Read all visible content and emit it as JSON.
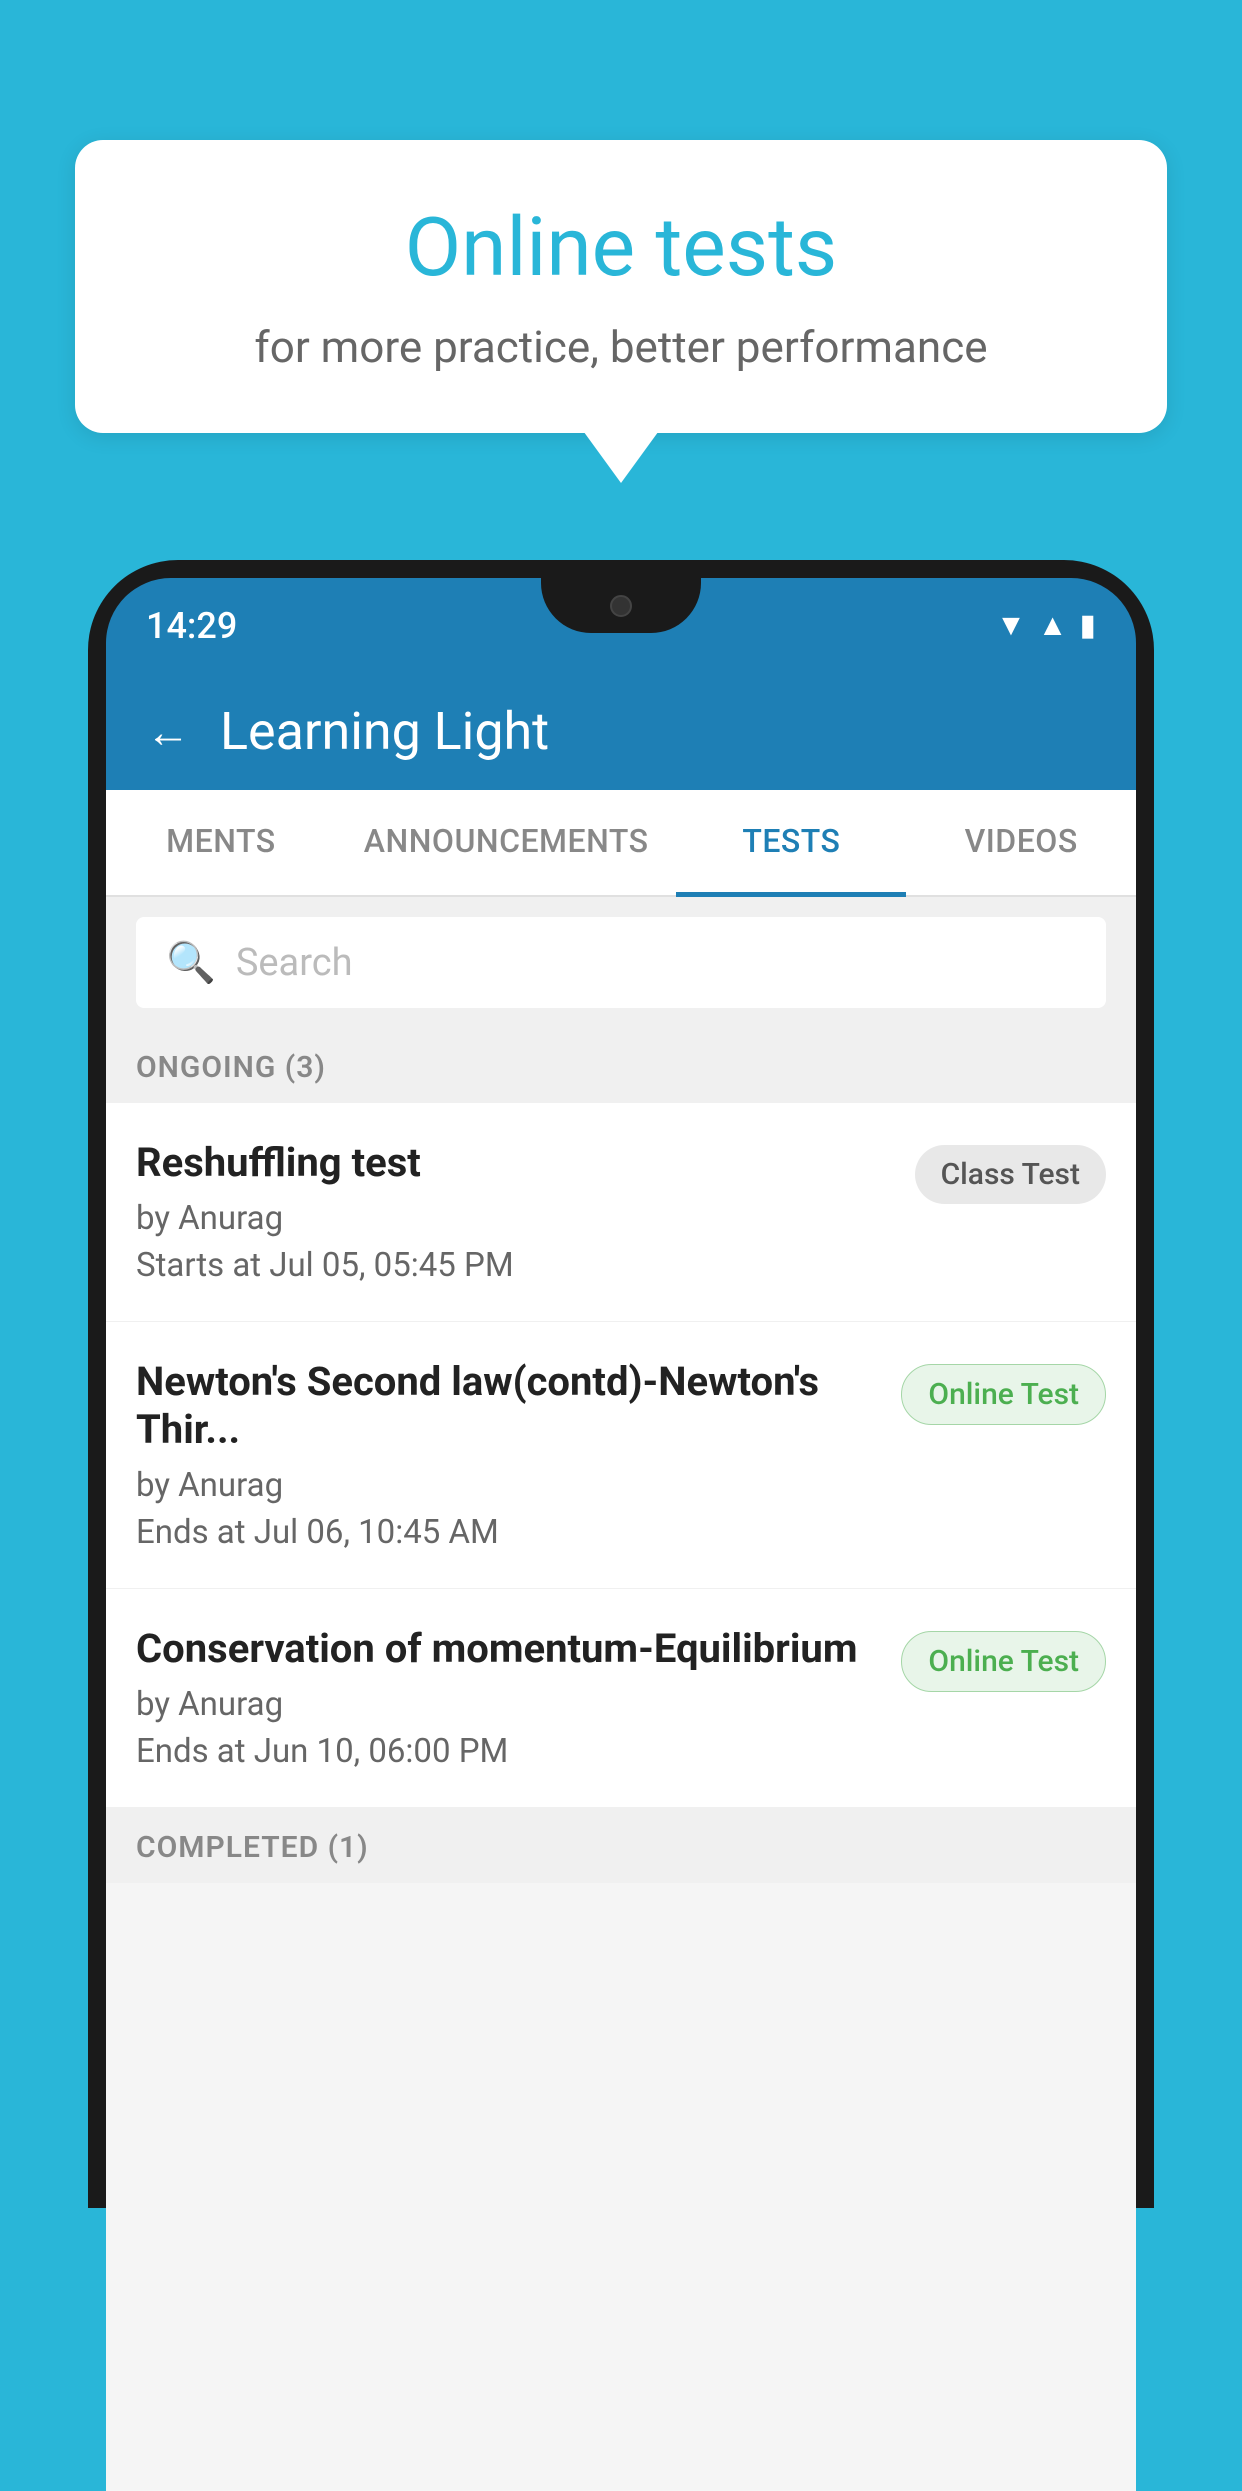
{
  "background": {
    "color": "#29b6d8"
  },
  "speech_bubble": {
    "title": "Online tests",
    "subtitle": "for more practice, better performance"
  },
  "phone": {
    "status_bar": {
      "time": "14:29",
      "wifi_icon": "▾",
      "signal_icon": "▲",
      "battery_icon": "▪"
    },
    "app_header": {
      "back_label": "←",
      "title": "Learning Light"
    },
    "tabs": [
      {
        "label": "MENTS",
        "active": false
      },
      {
        "label": "ANNOUNCEMENTS",
        "active": false
      },
      {
        "label": "TESTS",
        "active": true
      },
      {
        "label": "VIDEOS",
        "active": false
      }
    ],
    "search": {
      "placeholder": "Search"
    },
    "ongoing_section": {
      "label": "ONGOING (3)"
    },
    "tests": [
      {
        "name": "Reshuffling test",
        "author": "by Anurag",
        "time_label": "Starts at",
        "time": "Jul 05, 05:45 PM",
        "badge": "Class Test",
        "badge_type": "class"
      },
      {
        "name": "Newton's Second law(contd)-Newton's Thir...",
        "author": "by Anurag",
        "time_label": "Ends at",
        "time": "Jul 06, 10:45 AM",
        "badge": "Online Test",
        "badge_type": "online"
      },
      {
        "name": "Conservation of momentum-Equilibrium",
        "author": "by Anurag",
        "time_label": "Ends at",
        "time": "Jun 10, 06:00 PM",
        "badge": "Online Test",
        "badge_type": "online"
      }
    ],
    "completed_section": {
      "label": "COMPLETED (1)"
    }
  }
}
